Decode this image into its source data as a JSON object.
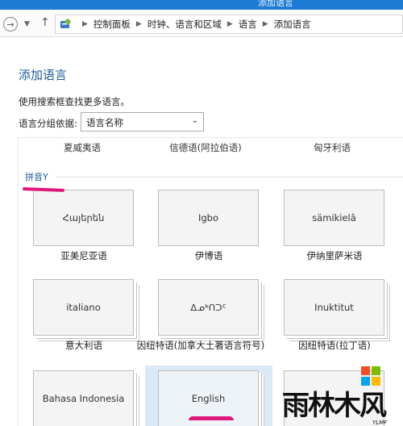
{
  "window": {
    "title": "添加语言"
  },
  "nav": {
    "back_icon": "back-arrow-icon",
    "breadcrumb": [
      "控制面板",
      "时钟、语言和区域",
      "语言",
      "添加语言"
    ]
  },
  "page": {
    "title": "添加语言",
    "description": "使用搜索框查找更多语言。",
    "group_by_label": "语言分组依据:",
    "group_by_value": "语言名称"
  },
  "list": {
    "cut_row": [
      "夏威夷语",
      "信德语(阿拉伯语)",
      "匈牙利语"
    ],
    "group_header": "拼音Y",
    "tiles": [
      {
        "native": "Հայերեն",
        "name": "亚美尼亚语"
      },
      {
        "native": "Igbo",
        "name": "伊博语"
      },
      {
        "native": "sämikielâ",
        "name": "伊纳里萨米语"
      },
      {
        "native": "italiano",
        "name": "意大利语"
      },
      {
        "native": "ᐃᓄᒃᑎᑐᑦ",
        "name": "因纽特语(加拿大土著语言符号)"
      },
      {
        "native": "Inuktitut",
        "name": "因纽特语(拉丁语)"
      },
      {
        "native": "Bahasa Indonesia",
        "name": ""
      },
      {
        "native": "English",
        "name": ""
      }
    ]
  },
  "watermark": {
    "text": "雨林木风",
    "sub": "YLMF"
  },
  "colors": {
    "accent": "#1e5a9c",
    "annotation": "#e0177a",
    "titlebar": "#1d7bd3"
  }
}
